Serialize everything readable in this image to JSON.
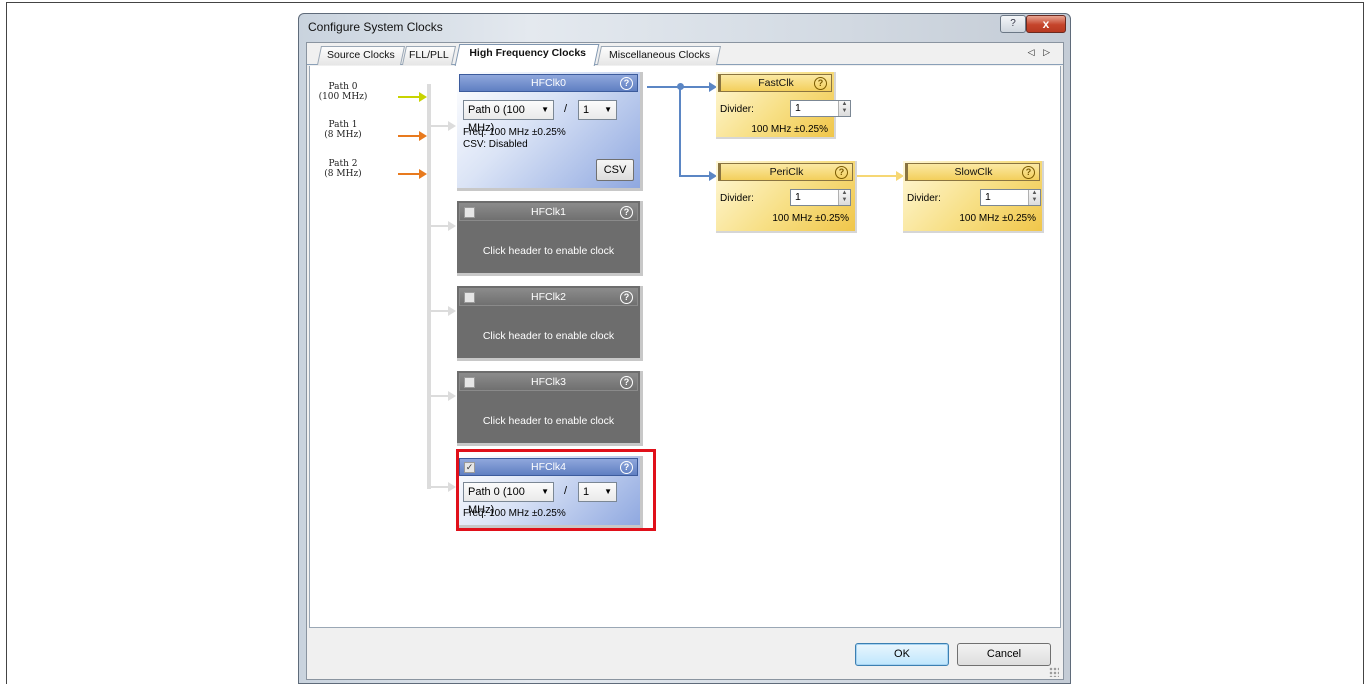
{
  "window": {
    "title": "Configure System Clocks",
    "help": "?",
    "close": "x"
  },
  "tabs": [
    {
      "label": "Source Clocks"
    },
    {
      "label": "FLL/PLL"
    },
    {
      "label": "High Frequency Clocks"
    },
    {
      "label": "Miscellaneous Clocks"
    }
  ],
  "tab_scroll": "◁ ▷",
  "paths": [
    {
      "name": "Path 0",
      "freq": "(100 MHz)"
    },
    {
      "name": "Path 1",
      "freq": "(8 MHz)"
    },
    {
      "name": "Path 2",
      "freq": "(8 MHz)"
    }
  ],
  "hfclk0": {
    "title": "HFClk0",
    "source": "Path 0 (100 MHz)",
    "divider": "1",
    "freq": "Freq: 100 MHz ±0.25%",
    "csv_status": "CSV: Disabled",
    "csv_button": "CSV",
    "help": "?"
  },
  "hfclk1": {
    "title": "HFClk1",
    "message": "Click header to enable clock",
    "help": "?"
  },
  "hfclk2": {
    "title": "HFClk2",
    "message": "Click header to enable clock",
    "help": "?"
  },
  "hfclk3": {
    "title": "HFClk3",
    "message": "Click header to enable clock",
    "help": "?"
  },
  "hfclk4": {
    "title": "HFClk4",
    "checked": "✓",
    "source": "Path 0 (100 MHz)",
    "divider": "1",
    "freq": "Freq: 100 MHz ±0.25%",
    "help": "?"
  },
  "fastclk": {
    "title": "FastClk",
    "divider_label": "Divider:",
    "divider": "1",
    "freq": "100 MHz ±0.25%",
    "help": "?"
  },
  "periclk": {
    "title": "PeriClk",
    "divider_label": "Divider:",
    "divider": "1",
    "freq": "100 MHz ±0.25%",
    "help": "?"
  },
  "slowclk": {
    "title": "SlowClk",
    "divider_label": "Divider:",
    "divider": "1",
    "freq": "100 MHz ±0.25%",
    "help": "?"
  },
  "divider_sep": "/",
  "buttons": {
    "ok": "OK",
    "cancel": "Cancel"
  }
}
